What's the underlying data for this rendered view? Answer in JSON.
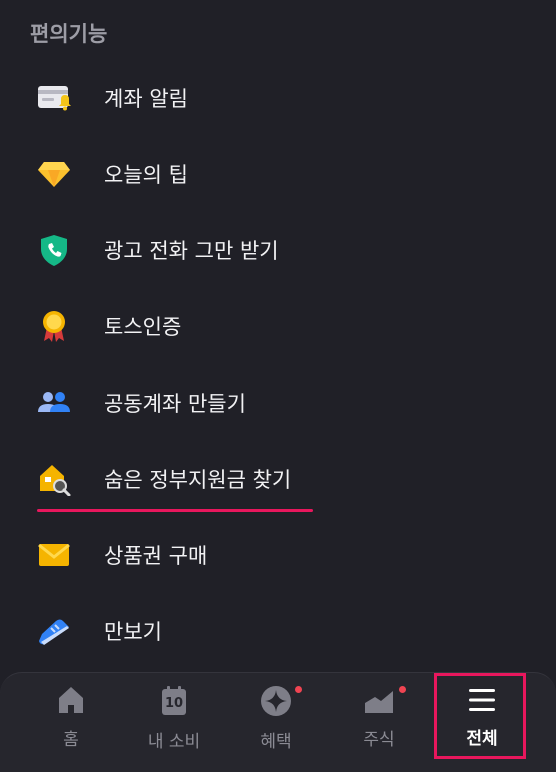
{
  "section": {
    "title": "편의기능"
  },
  "menu": [
    {
      "label": "계좌 알림",
      "icon": "account-bell-icon"
    },
    {
      "label": "오늘의 팁",
      "icon": "diamond-icon"
    },
    {
      "label": "광고 전화 그만 받기",
      "icon": "shield-phone-icon"
    },
    {
      "label": "토스인증",
      "icon": "medal-icon"
    },
    {
      "label": "공동계좌 만들기",
      "icon": "people-icon"
    },
    {
      "label": "숨은 정부지원금 찾기",
      "icon": "house-search-icon"
    },
    {
      "label": "상품권 구매",
      "icon": "envelope-icon"
    },
    {
      "label": "만보기",
      "icon": "sneaker-icon"
    }
  ],
  "nav": [
    {
      "label": "홈",
      "icon": "home-icon",
      "badge": false
    },
    {
      "label": "내 소비",
      "icon": "calendar-icon",
      "icon_text": "10",
      "badge": false
    },
    {
      "label": "혜택",
      "icon": "sparkle-icon",
      "badge": true
    },
    {
      "label": "주식",
      "icon": "chart-icon",
      "badge": true
    },
    {
      "label": "전체",
      "icon": "hamburger-menu-icon",
      "badge": false,
      "active": true
    }
  ],
  "colors": {
    "background": "#202027",
    "accent": "#e8175d",
    "badge": "#f04452"
  }
}
